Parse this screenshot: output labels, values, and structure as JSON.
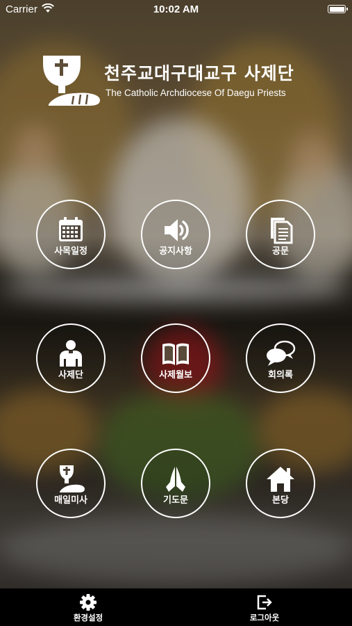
{
  "status_bar": {
    "carrier": "Carrier",
    "time": "10:02 AM",
    "battery_level_pct": 100
  },
  "header": {
    "title_ko": "천주교대구대교구 사제단",
    "title_en": "The Catholic Archdiocese Of Daegu Priests",
    "logo_icon": "chalice-bread-icon"
  },
  "menu": [
    {
      "label": "사목일정",
      "icon": "calendar-icon"
    },
    {
      "label": "공지사항",
      "icon": "speaker-icon"
    },
    {
      "label": "공문",
      "icon": "documents-icon"
    },
    {
      "label": "사제단",
      "icon": "priest-icon"
    },
    {
      "label": "사제월보",
      "icon": "open-book-icon"
    },
    {
      "label": "회의록",
      "icon": "chat-bubbles-icon"
    },
    {
      "label": "매일미사",
      "icon": "chalice-bread-icon"
    },
    {
      "label": "기도문",
      "icon": "praying-hands-icon"
    },
    {
      "label": "본당",
      "icon": "home-icon"
    }
  ],
  "tab_bar": {
    "settings_label": "환경설정",
    "settings_icon": "gear-icon",
    "logout_label": "로그아웃",
    "logout_icon": "logout-icon"
  },
  "colors": {
    "foreground": "#ffffff",
    "tab_bar_background": "#000000"
  }
}
